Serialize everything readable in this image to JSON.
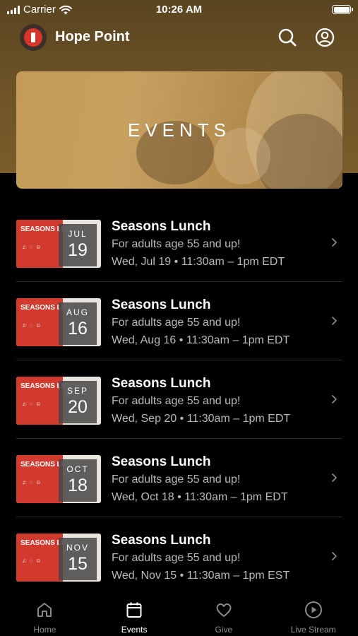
{
  "status_bar": {
    "carrier": "Carrier",
    "time": "10:26 AM"
  },
  "header": {
    "title": "Hope Point",
    "icons": [
      "logo",
      "search-icon",
      "account-icon"
    ]
  },
  "hero": {
    "title": "EVENTS"
  },
  "events": [
    {
      "thumb_title": "SEASONS LUNCH",
      "month": "JUL",
      "day": "19",
      "title": "Seasons Lunch",
      "subtitle": "For adults age 55 and up!",
      "when": "Wed, Jul 19 • 11:30am – 1pm EDT"
    },
    {
      "thumb_title": "SEASONS LUNCH",
      "month": "AUG",
      "day": "16",
      "title": "Seasons Lunch",
      "subtitle": "For adults age 55 and up!",
      "when": "Wed, Aug 16 • 11:30am – 1pm EDT"
    },
    {
      "thumb_title": "SEASONS LUNCH",
      "month": "SEP",
      "day": "20",
      "title": "Seasons Lunch",
      "subtitle": "For adults age 55 and up!",
      "when": "Wed, Sep 20 • 11:30am – 1pm EDT"
    },
    {
      "thumb_title": "SEASONS LUNCH",
      "month": "OCT",
      "day": "18",
      "title": "Seasons Lunch",
      "subtitle": "For adults age 55 and up!",
      "when": "Wed, Oct 18 • 11:30am – 1pm EDT"
    },
    {
      "thumb_title": "SEASONS LUNCH",
      "month": "NOV",
      "day": "15",
      "title": "Seasons Lunch",
      "subtitle": "For adults age 55 and up!",
      "when": "Wed, Nov 15 • 11:30am – 1pm EST"
    }
  ],
  "tabs": [
    {
      "label": "Home",
      "icon": "home-icon",
      "active": false
    },
    {
      "label": "Events",
      "icon": "calendar-icon",
      "active": true
    },
    {
      "label": "Give",
      "icon": "heart-icon",
      "active": false
    },
    {
      "label": "Live Stream",
      "icon": "play-icon",
      "active": false
    }
  ],
  "colors": {
    "accent_red": "#d23a2e",
    "header_brown": "#6e5427",
    "hero_gold": "#c39a58",
    "background": "#000000",
    "muted_text": "#b9b9b9"
  }
}
